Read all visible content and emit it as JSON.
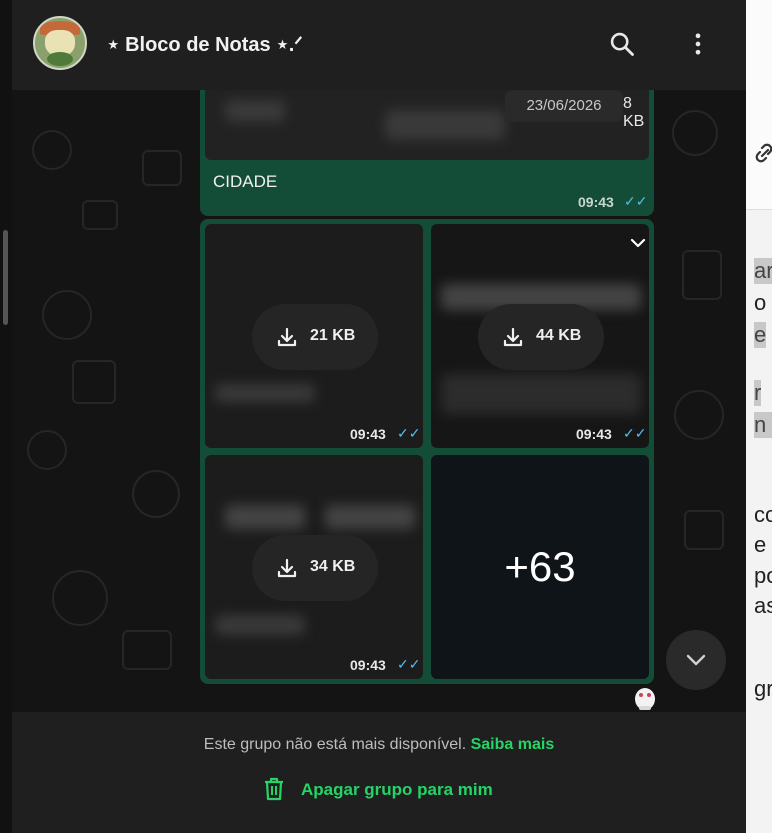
{
  "header": {
    "title": "⋆ Bloco de Notas ⋆.ᐟ"
  },
  "icons": {
    "search": "search-icon",
    "menu": "more-vert-icon",
    "download": "download-icon",
    "chevron": "chevron-down-icon",
    "trash": "trash-icon"
  },
  "messages": {
    "top": {
      "date": "23/06/2026",
      "size": "8 KB",
      "caption": "CIDADE",
      "time": "09:43"
    },
    "grid": [
      {
        "size": "21 KB",
        "time": "09:43"
      },
      {
        "size": "44 KB",
        "time": "09:43"
      },
      {
        "size": "34 KB",
        "time": "09:43"
      },
      {
        "more": "+63"
      }
    ]
  },
  "footer": {
    "notice": "Este grupo não está mais disponível.",
    "learn_more": "Saiba mais",
    "delete_label": "Apagar grupo para mim"
  },
  "right_panel": {
    "fragments": [
      "ara",
      "o d",
      "e",
      "r",
      "n e",
      "con",
      "e",
      "pos",
      "as",
      "gru"
    ]
  },
  "colors": {
    "accent": "#25d366",
    "bubble": "#144d37",
    "read_ticks": "#53bdeb"
  }
}
